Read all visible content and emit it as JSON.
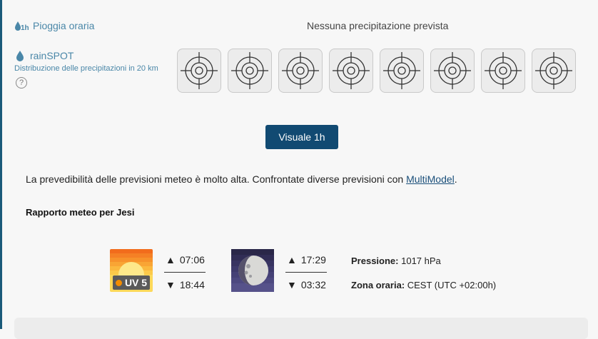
{
  "hourly": {
    "icon": "rain-hourly-icon",
    "label": "Pioggia oraria",
    "status": "Nessuna precipitazione prevista"
  },
  "rainspot": {
    "title": "rainSPOT",
    "subtitle": "Distribuzione delle precipitazioni in 20 km",
    "help": "?",
    "spot_count": 8
  },
  "button_hourly": "Visuale 1h",
  "predictability": {
    "text": "La prevedibilità delle previsioni meteo è molto alta. Confrontate diverse previsioni con ",
    "link": "MultiModel",
    "suffix": "."
  },
  "report": {
    "title": "Rapporto meteo per Jesi",
    "uv_label": "UV 5",
    "sunrise": "07:06",
    "sunset": "18:44",
    "moonrise": "17:29",
    "moonset": "03:32",
    "pressure_label": "Pressione:",
    "pressure_value": "1017 hPa",
    "timezone_label": "Zona oraria:",
    "timezone_value": "CEST (UTC +02:00h)"
  },
  "colors": {
    "accent": "#4a87a8",
    "button": "#114a72",
    "uv_dot": "#f28c00"
  }
}
